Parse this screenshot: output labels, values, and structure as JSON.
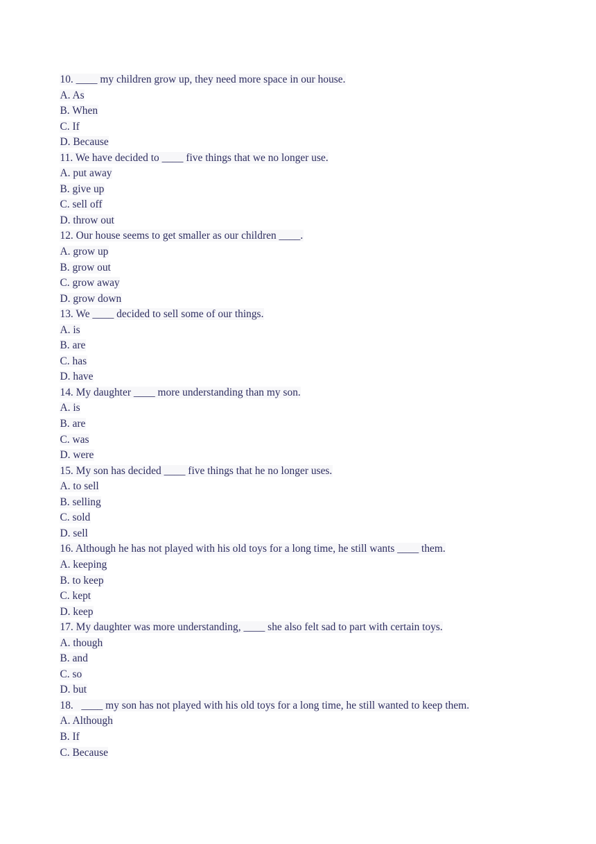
{
  "document": {
    "type": "multiple-choice-worksheet",
    "text_color": "#2e2e60",
    "background_color": "#ffffff",
    "highlight_color": "#f7f7f9",
    "blank_marker": "____",
    "items": [
      {
        "number": "10.",
        "stem": "10. ____ my children grow up, they need more space in our house.",
        "options": [
          "A. As",
          "B. When",
          "C. If",
          "D. Because"
        ]
      },
      {
        "number": "11.",
        "stem": "11. We have decided to ____ five things that we no longer use.",
        "options": [
          "A. put away",
          "B. give up",
          "C. sell off",
          "D. throw out"
        ]
      },
      {
        "number": "12.",
        "stem": "12. Our house seems to get smaller as our children ____.",
        "options": [
          "A. grow up",
          "B. grow out",
          "C. grow away",
          "D. grow down"
        ]
      },
      {
        "number": "13.",
        "stem": "13. We ____ decided to sell some of our things.",
        "options": [
          "A. is",
          "B. are",
          "C. has",
          "D. have"
        ]
      },
      {
        "number": "14.",
        "stem": "14. My daughter ____ more understanding than my son.",
        "options": [
          "A. is",
          "B. are",
          "C. was",
          "D. were"
        ]
      },
      {
        "number": "15.",
        "stem": "15. My son has decided ____ five things that he no longer uses.",
        "options": [
          "A. to sell",
          "B. selling",
          "C. sold",
          "D. sell"
        ]
      },
      {
        "number": "16.",
        "stem": "16. Although he has not played with his old toys for a long time, he still wants ____ them.",
        "options": [
          "A. keeping",
          "B. to keep",
          "C. kept",
          "D. keep"
        ]
      },
      {
        "number": "17.",
        "stem": "17. My daughter was more understanding, ____ she also felt sad to part with certain toys.",
        "options": [
          "A. though",
          "B. and",
          "C. so",
          "D. but"
        ]
      },
      {
        "number": "18.",
        "stem": "18.   ____ my son has not played with his old toys for a long time, he still wanted to keep them.",
        "options": [
          "A. Although",
          "B. If",
          "C. Because"
        ]
      }
    ]
  }
}
